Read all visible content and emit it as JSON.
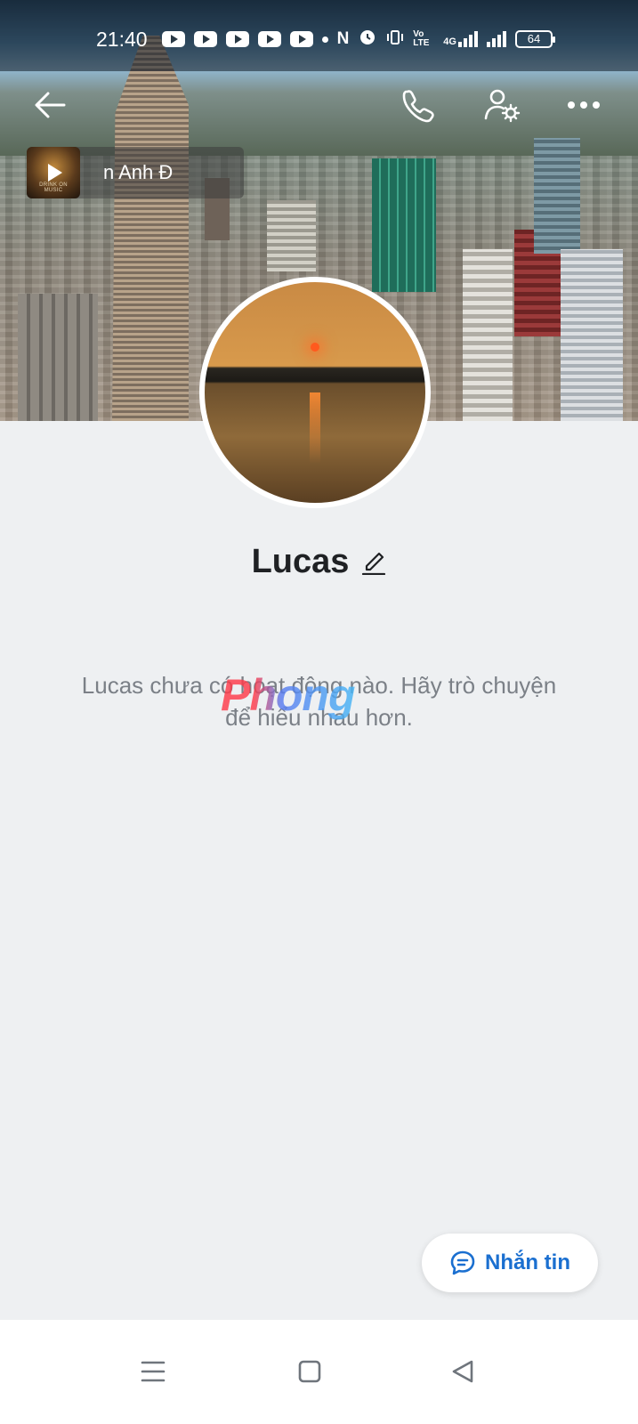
{
  "status_bar": {
    "time": "21:40",
    "volte_label": "Vo LTE",
    "network_label": "4G",
    "battery": "64"
  },
  "music": {
    "thumb_caption": "DRINK ON MUSIC",
    "song_text": "n Anh     Đ"
  },
  "profile": {
    "name": "Lucas"
  },
  "empty_state": {
    "message": "Lucas chưa có hoạt động nào. Hãy trò chuyện để hiểu nhau hơn."
  },
  "watermark": "Phong",
  "actions": {
    "message_button": "Nhắn tin"
  },
  "colors": {
    "accent": "#1a6fd0",
    "page_background": "#eef0f2"
  }
}
